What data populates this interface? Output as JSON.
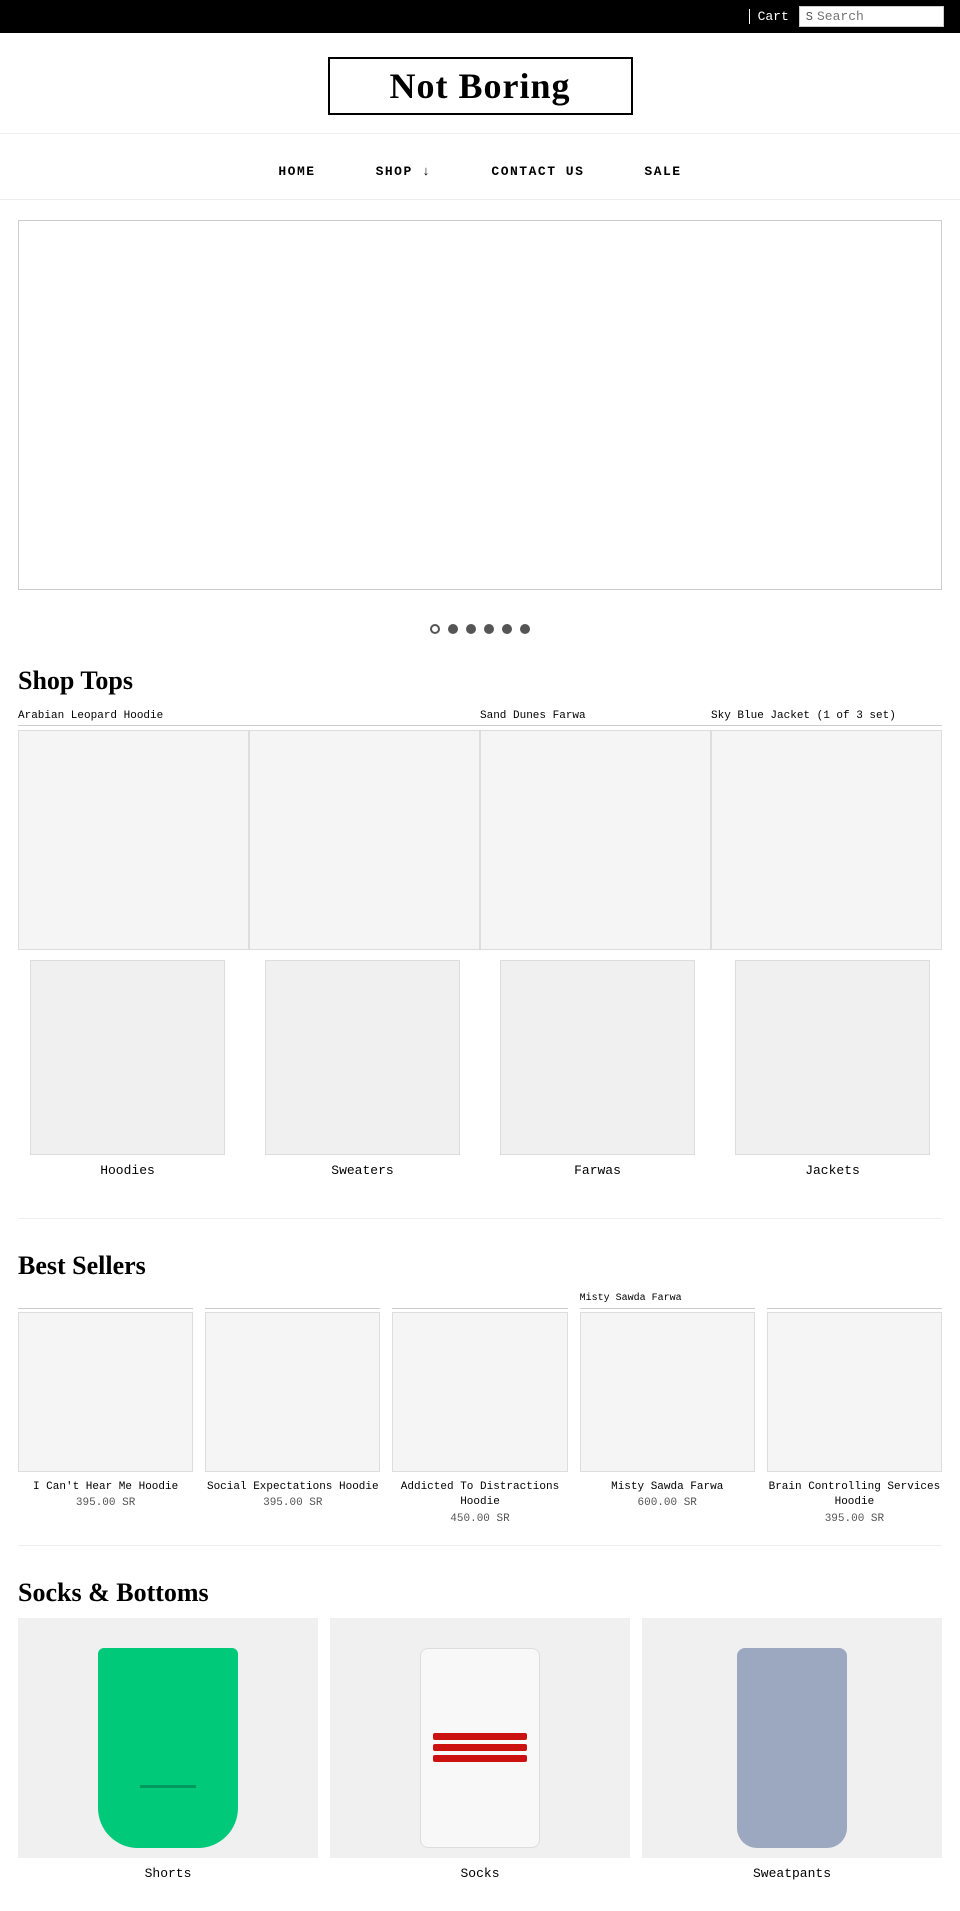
{
  "topbar": {
    "cart_label": "Cart",
    "search_placeholder": "Search",
    "search_icon": "S"
  },
  "header": {
    "site_title": "Not Boring"
  },
  "nav": {
    "items": [
      {
        "label": "HOME",
        "id": "home"
      },
      {
        "label": "SHOP ↓",
        "id": "shop"
      },
      {
        "label": "CONTACT US",
        "id": "contact"
      },
      {
        "label": "SALE",
        "id": "sale"
      }
    ]
  },
  "hero_slider": {
    "dots": [
      {
        "active": true
      },
      {
        "active": false
      },
      {
        "active": false
      },
      {
        "active": false
      },
      {
        "active": false
      },
      {
        "active": false
      }
    ]
  },
  "shop_tops": {
    "section_title": "Shop Tops",
    "items": [
      {
        "label": "Arabian Leopard Hoodie",
        "caption": ""
      },
      {
        "label": "",
        "caption": ""
      },
      {
        "label": "Sand Dunes Farwa",
        "caption": ""
      },
      {
        "label": "Sky Blue Jacket (1 of 3 set)",
        "caption": ""
      }
    ]
  },
  "categories": {
    "items": [
      {
        "label": "Hoodies"
      },
      {
        "label": "Sweaters"
      },
      {
        "label": "Farwas"
      },
      {
        "label": "Jackets"
      }
    ]
  },
  "best_sellers": {
    "section_title": "Best Sellers",
    "items": [
      {
        "label": "",
        "name": "I Can't Hear Me Hoodie",
        "price": "395.00 SR"
      },
      {
        "label": "",
        "name": "Social Expectations Hoodie",
        "price": "395.00 SR"
      },
      {
        "label": "",
        "name": "Addicted To Distractions Hoodie",
        "price": "450.00 SR"
      },
      {
        "label": "Misty Sawda Farwa",
        "name": "Misty Sawda Farwa",
        "price": "600.00 SR"
      },
      {
        "label": "",
        "name": "Brain Controlling Services Hoodie",
        "price": "395.00 SR"
      }
    ]
  },
  "socks_bottoms": {
    "section_title": "Socks & Bottoms",
    "items": [
      {
        "label": "Shorts"
      },
      {
        "label": "Socks"
      },
      {
        "label": "Sweatpants"
      }
    ]
  }
}
